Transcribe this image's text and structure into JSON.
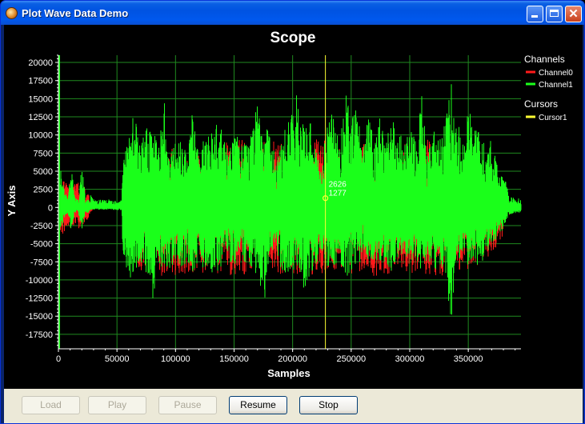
{
  "window": {
    "title": "Plot Wave Data Demo",
    "minimize_glyph": "",
    "maximize_glyph": "",
    "close_glyph": "✕"
  },
  "buttons": [
    {
      "label": "Load",
      "enabled": false
    },
    {
      "label": "Play",
      "enabled": false
    },
    {
      "label": "Pause",
      "enabled": false
    },
    {
      "label": "Resume",
      "enabled": true
    },
    {
      "label": "Stop",
      "enabled": true
    }
  ],
  "colors": {
    "background": "#000000",
    "grid": "#1f8a1f",
    "channel0": "#ff1a1a",
    "channel1": "#1aff1a",
    "cursor": "#ffff33",
    "text": "#ffffff"
  },
  "chart_data": {
    "type": "line",
    "title": "Scope",
    "xlabel": "Samples",
    "ylabel": "Y Axis",
    "xlim": [
      0,
      395000
    ],
    "ylim": [
      -19500,
      21000
    ],
    "xticks": [
      0,
      50000,
      100000,
      150000,
      200000,
      250000,
      300000,
      350000
    ],
    "yticks": [
      20000,
      17500,
      15000,
      12500,
      10000,
      7500,
      5000,
      2500,
      0,
      -2500,
      -5000,
      -7500,
      -10000,
      -12500,
      -15000,
      -17500
    ],
    "grid": true,
    "legend": {
      "position": "right",
      "groups": [
        {
          "title": "Channels",
          "entries": [
            {
              "name": "Channel0",
              "color": "#ff1a1a"
            },
            {
              "name": "Channel1",
              "color": "#1aff1a"
            }
          ]
        },
        {
          "title": "Cursors",
          "entries": [
            {
              "name": "Cursor1",
              "color": "#ffff33"
            }
          ]
        }
      ]
    },
    "cursor": {
      "x": 228000,
      "y": 1277,
      "label_x": "2626",
      "label_y": "1277"
    },
    "series": [
      {
        "name": "Channel1",
        "color": "#1aff1a",
        "envelope": {
          "x": [
            0,
            1500,
            5000,
            8000,
            11000,
            14000,
            17000,
            20000,
            23000,
            26000,
            28000,
            30000,
            40000,
            54000,
            55000,
            60000,
            65000,
            70000,
            75000,
            80000,
            85000,
            90000,
            95000,
            100000,
            105000,
            110000,
            115000,
            120000,
            125000,
            130000,
            135000,
            140000,
            145000,
            150000,
            155000,
            160000,
            165000,
            170000,
            175000,
            180000,
            185000,
            190000,
            195000,
            200000,
            205000,
            210000,
            215000,
            220000,
            225000,
            230000,
            235000,
            240000,
            245000,
            250000,
            255000,
            260000,
            265000,
            270000,
            275000,
            280000,
            285000,
            290000,
            295000,
            300000,
            305000,
            310000,
            315000,
            320000,
            325000,
            330000,
            335000,
            340000,
            345000,
            350000,
            355000,
            360000,
            365000,
            370000,
            375000,
            380000,
            385000,
            395000
          ],
          "max": [
            6000,
            5800,
            2500,
            1500,
            6000,
            1500,
            1000,
            6000,
            1500,
            1000,
            1800,
            1200,
            1100,
            1100,
            7800,
            9500,
            14000,
            8000,
            12000,
            12000,
            9000,
            15500,
            8000,
            9000,
            11000,
            8000,
            14500,
            7000,
            11000,
            10000,
            13000,
            10500,
            7500,
            12000,
            8000,
            9500,
            10000,
            15000,
            8000,
            14000,
            6000,
            9000,
            12000,
            13500,
            16500,
            10500,
            12000,
            8000,
            5000,
            14000,
            12500,
            8500,
            16000,
            12000,
            14500,
            7500,
            15000,
            9000,
            13000,
            11000,
            12000,
            11500,
            8500,
            11000,
            9500,
            16000,
            7000,
            12000,
            10000,
            13000,
            18000,
            12500,
            9500,
            14000,
            11500,
            11000,
            8000,
            9500,
            6000,
            5000,
            1500,
            1200
          ],
          "min": [
            -3800,
            -3600,
            -1500,
            -1000,
            -3400,
            -1000,
            -800,
            -3400,
            -800,
            -700,
            -400,
            -300,
            -300,
            -400,
            -7000,
            -11000,
            -9500,
            -7500,
            -9000,
            -13500,
            -8500,
            -8000,
            -9500,
            -7000,
            -8500,
            -7500,
            -9000,
            -8000,
            -8500,
            -9500,
            -9000,
            -8500,
            -7000,
            -8500,
            -6000,
            -8000,
            -9000,
            -9500,
            -15000,
            -8000,
            -5000,
            -8500,
            -9500,
            -9000,
            -8000,
            -12000,
            -9000,
            -8500,
            -6000,
            -9000,
            -8500,
            -8000,
            -10000,
            -8500,
            -9500,
            -6000,
            -8500,
            -7000,
            -8000,
            -7500,
            -9500,
            -8000,
            -6500,
            -7500,
            -7000,
            -10000,
            -6500,
            -9000,
            -8000,
            -8500,
            -16500,
            -7500,
            -7000,
            -8000,
            -7500,
            -8500,
            -6500,
            -5000,
            -4500,
            -3000,
            -1000,
            -700
          ]
        }
      },
      {
        "name": "Channel0",
        "color": "#ff1a1a",
        "envelope": {
          "x": [
            0,
            2000,
            10000,
            20000,
            30000,
            54000,
            60000,
            90000,
            120000,
            150000,
            180000,
            210000,
            240000,
            270000,
            300000,
            330000,
            360000,
            378000,
            382000,
            388000,
            395000
          ],
          "max": [
            4500,
            4000,
            3500,
            3500,
            500,
            500,
            6500,
            9000,
            8000,
            9500,
            9000,
            10000,
            9000,
            9500,
            9000,
            10500,
            8000,
            4500,
            1200,
            800,
            700
          ],
          "min": [
            -4200,
            -4000,
            -3000,
            -3000,
            -200,
            -200,
            -8500,
            -9500,
            -9000,
            -9500,
            -9000,
            -9500,
            -9000,
            -9500,
            -9000,
            -9500,
            -8000,
            -5000,
            -1500,
            -700,
            -600
          ]
        }
      }
    ]
  }
}
